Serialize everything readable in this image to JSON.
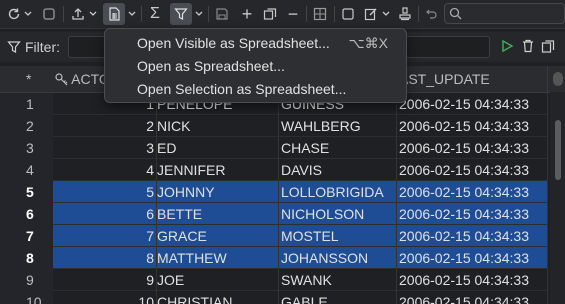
{
  "toolbar": {
    "icons": [
      "refresh-icon",
      "chevron-down-icon",
      "stop-icon",
      "export-icon",
      "chevron-down-icon",
      "open-spreadsheet-icon",
      "chevron-down-icon",
      "sum-icon",
      "filter-icon",
      "chevron-down-icon",
      "save-icon",
      "add-row-icon",
      "duplicate-icon",
      "remove-row-icon",
      "grid-icon",
      "checkbox-icon",
      "edit-icon",
      "chevron-down-icon",
      "stamp-icon",
      "undo-icon",
      "search-icon"
    ]
  },
  "filter": {
    "label": "Filter:",
    "value": ""
  },
  "columns": [
    "*",
    "ACTO",
    "",
    "",
    "AST_UPDATE"
  ],
  "rows": [
    {
      "n": "1",
      "id": "1",
      "first": "PENELOPE",
      "last": "GUINESS",
      "updated": "2006-02-15 04:34:33",
      "selected": false
    },
    {
      "n": "2",
      "id": "2",
      "first": "NICK",
      "last": "WAHLBERG",
      "updated": "2006-02-15 04:34:33",
      "selected": false
    },
    {
      "n": "3",
      "id": "3",
      "first": "ED",
      "last": "CHASE",
      "updated": "2006-02-15 04:34:33",
      "selected": false
    },
    {
      "n": "4",
      "id": "4",
      "first": "JENNIFER",
      "last": "DAVIS",
      "updated": "2006-02-15 04:34:33",
      "selected": false
    },
    {
      "n": "5",
      "id": "5",
      "first": "JOHNNY",
      "last": "LOLLOBRIGIDA",
      "updated": "2006-02-15 04:34:33",
      "selected": true
    },
    {
      "n": "6",
      "id": "6",
      "first": "BETTE",
      "last": "NICHOLSON",
      "updated": "2006-02-15 04:34:33",
      "selected": true
    },
    {
      "n": "7",
      "id": "7",
      "first": "GRACE",
      "last": "MOSTEL",
      "updated": "2006-02-15 04:34:33",
      "selected": true
    },
    {
      "n": "8",
      "id": "8",
      "first": "MATTHEW",
      "last": "JOHANSSON",
      "updated": "2006-02-15 04:34:33",
      "selected": true
    },
    {
      "n": "9",
      "id": "9",
      "first": "JOE",
      "last": "SWANK",
      "updated": "2006-02-15 04:34:33",
      "selected": false
    },
    {
      "n": "10",
      "id": "10",
      "first": "CHRISTIAN",
      "last": "GABLE",
      "updated": "2006-02-15 04:34:33",
      "selected": false
    }
  ],
  "menu": {
    "items": [
      {
        "label": "Open Visible as Spreadsheet...",
        "shortcut": "⌥⌘X"
      },
      {
        "label": "Open as Spreadsheet...",
        "shortcut": ""
      },
      {
        "label": "Open Selection as Spreadsheet...",
        "shortcut": ""
      }
    ]
  },
  "colors": {
    "selection": "#1e4d96",
    "background": "#202124",
    "run_green": "#3fae5a"
  }
}
